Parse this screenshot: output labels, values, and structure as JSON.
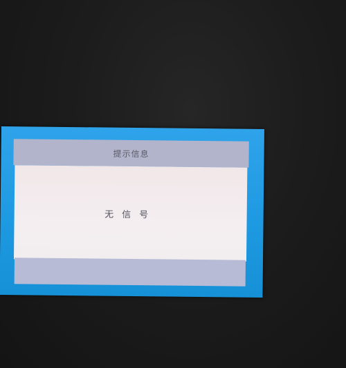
{
  "dialog": {
    "title": "提示信息",
    "message": "无信号"
  },
  "colors": {
    "background": "#1a1a1a",
    "frame": "#1e9ae2",
    "titlebar": "#b2b4cb",
    "body": "#f3ecee",
    "footer": "#b8bbd6"
  }
}
